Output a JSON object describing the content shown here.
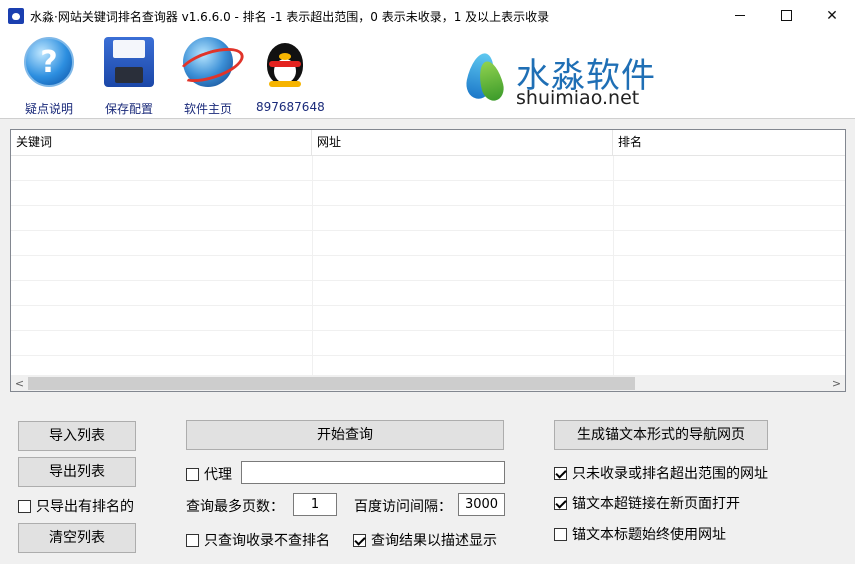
{
  "window": {
    "title": "水淼·网站关键词排名查询器 v1.6.6.0 - 排名 -1 表示超出范围，0 表示未收录，1 及以上表示收录",
    "minimize": "",
    "maximize": "",
    "close": "✕"
  },
  "toolbar": {
    "items": [
      {
        "label": "疑点说明",
        "icon": "help-icon"
      },
      {
        "label": "保存配置",
        "icon": "floppy-disk-icon"
      },
      {
        "label": "软件主页",
        "icon": "globe-icon"
      },
      {
        "label": "897687648",
        "icon": "qq-penguin-icon"
      }
    ],
    "brand_cn": "水淼软件",
    "brand_en": "shuimiao.net",
    "brand_colors": {
      "blue": "#1f6fb5",
      "green": "#3c9b2a"
    }
  },
  "table": {
    "columns": [
      "关键词",
      "网址",
      "排名"
    ],
    "rows": []
  },
  "scrollbar": {
    "left": "<",
    "right": ">"
  },
  "buttons": {
    "import": "导入列表",
    "export": "导出列表",
    "clear": "清空列表",
    "start": "开始查询",
    "generate": "生成锚文本形式的导航网页"
  },
  "options": {
    "only_ranked_export": {
      "label": "只导出有排名的",
      "checked": false
    },
    "proxy": {
      "label": "代理",
      "checked": false,
      "value": ""
    },
    "max_pages_label": "查询最多页数：",
    "max_pages": "1",
    "interval_label": "百度访问间隔：",
    "interval": "3000",
    "only_index": {
      "label": "只查询收录不查排名",
      "checked": false
    },
    "desc_display": {
      "label": "查询结果以描述显示",
      "checked": true
    },
    "not_indexed_urls": {
      "label": "只未收录或排名超出范围的网址",
      "checked": true
    },
    "open_new_page": {
      "label": "锚文本超链接在新页面打开",
      "checked": true
    },
    "title_use_url": {
      "label": "锚文本标题始终使用网址",
      "checked": false
    }
  }
}
